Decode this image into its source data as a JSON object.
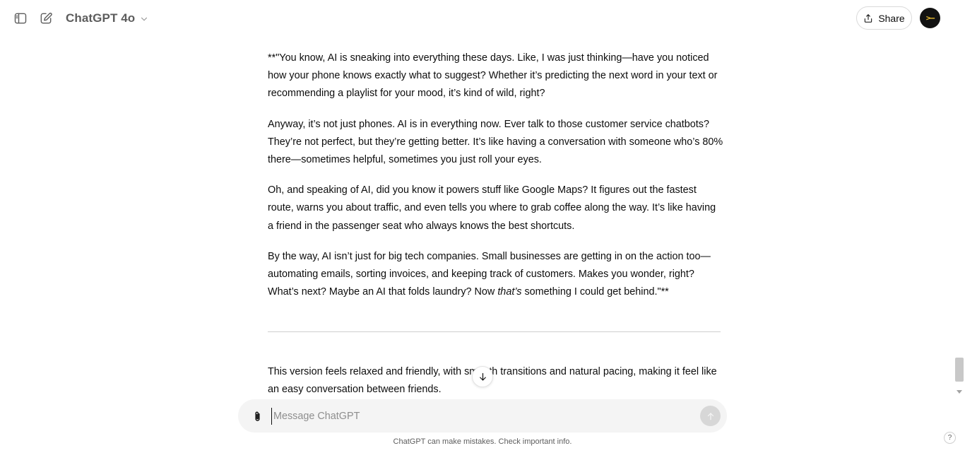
{
  "header": {
    "sidebar_icon": "sidebar-toggle-icon",
    "new_chat_icon": "new-chat-icon",
    "model_name": "ChatGPT 4o",
    "model_dropdown_icon": "chevron-down-icon",
    "share_label": "Share",
    "share_icon": "share-upload-icon",
    "avatar_glyph": ">–"
  },
  "conversation": {
    "paragraphs": [
      "**\"You know, AI is sneaking into everything these days. Like, I was just thinking—have you noticed how your phone knows exactly what to suggest? Whether it’s predicting the next word in your text or recommending a playlist for your mood, it’s kind of wild, right?",
      "Anyway, it’s not just phones. AI is in everything now. Ever talk to those customer service chatbots? They’re not perfect, but they’re getting better. It’s like having a conversation with someone who’s 80% there—sometimes helpful, sometimes you just roll your eyes.",
      "Oh, and speaking of AI, did you know it powers stuff like Google Maps? It figures out the fastest route, warns you about traffic, and even tells you where to grab coffee along the way. It’s like having a friend in the passenger seat who always knows the best shortcuts."
    ],
    "last_paragraph": {
      "before": "By the way, AI isn’t just for big tech companies. Small businesses are getting in on the action too—automating emails, sorting invoices, and keeping track of customers. Makes you wonder, right? What’s next? Maybe an AI that folds laundry? Now ",
      "emphasis": "that’s",
      "after": " something I could get behind.\"**"
    },
    "closing": "This version feels relaxed and friendly, with smooth transitions and natural pacing, making it feel like an easy conversation between friends."
  },
  "composer": {
    "placeholder": "Message ChatGPT",
    "value": "",
    "attach_icon": "paperclip-icon",
    "send_icon": "arrow-up-icon"
  },
  "scroll_down_icon": "arrow-down-icon",
  "disclaimer": "ChatGPT can make mistakes. Check important info.",
  "help_label": "?"
}
